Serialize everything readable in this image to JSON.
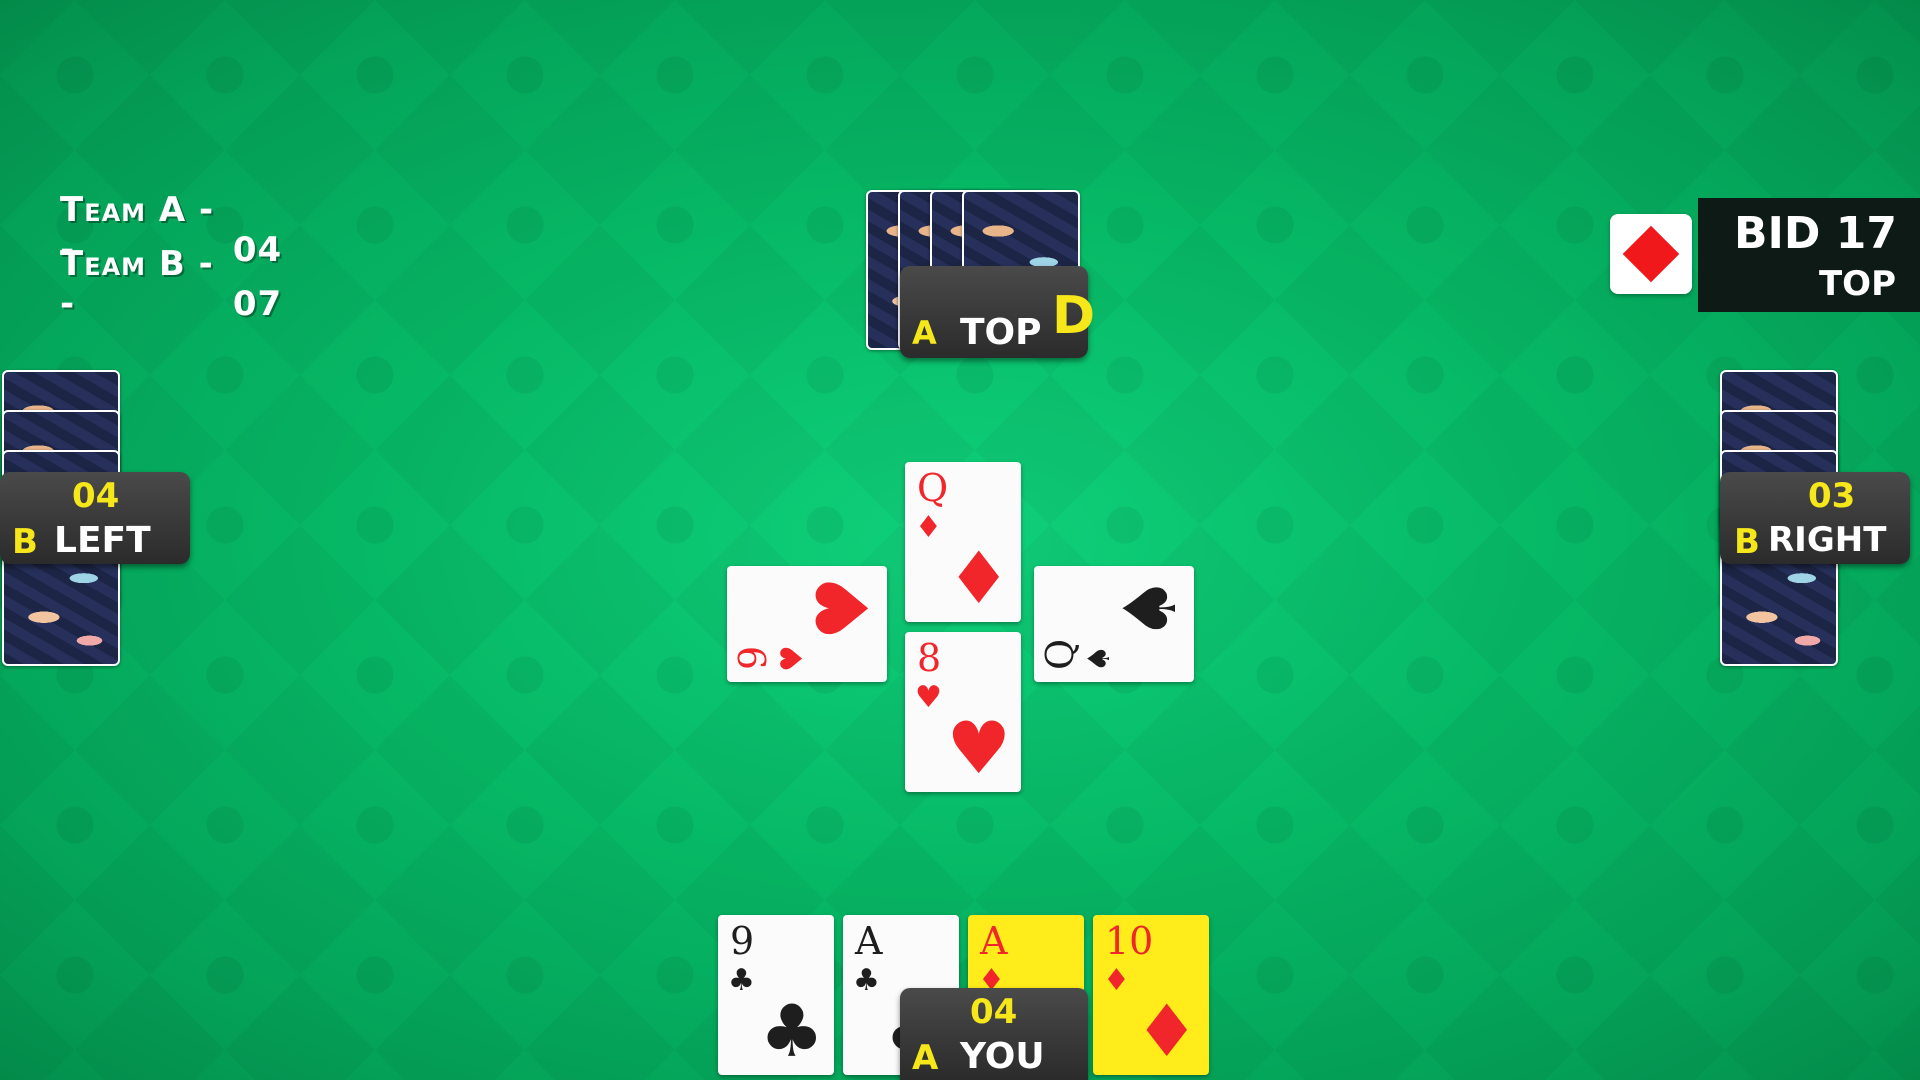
{
  "scoreboard": {
    "team_a_label": "Team A --",
    "team_a_score": "04",
    "team_b_label": "Team B --",
    "team_b_score": "07"
  },
  "bid": {
    "text": "BID 17",
    "by": "TOP",
    "trump_suit": "diamonds"
  },
  "players": {
    "top": {
      "team": "A",
      "name": "TOP",
      "dealer_badge": "D"
    },
    "left": {
      "team": "B",
      "name": "LEFT",
      "count": "04"
    },
    "right": {
      "team": "B",
      "name": "RIGHT",
      "count": "03"
    },
    "you": {
      "team": "A",
      "name": "YOU",
      "count": "04"
    }
  },
  "trick": {
    "top": {
      "rank": "Q",
      "suit": "♦"
    },
    "bottom": {
      "rank": "8",
      "suit": "♥"
    },
    "left": {
      "rank": "9",
      "suit": "♥"
    },
    "right": {
      "rank": "Q",
      "suit": "♠"
    }
  },
  "hand": [
    {
      "rank": "9",
      "suit": "♣",
      "highlight": false
    },
    {
      "rank": "A",
      "suit": "♣",
      "highlight": false
    },
    {
      "rank": "A",
      "suit": "♦",
      "highlight": true
    },
    {
      "rank": "10",
      "suit": "♦",
      "highlight": true
    }
  ],
  "colors": {
    "table_green": "#06b865",
    "highlight": "#ffec1a",
    "team_label": "#f6e71a",
    "red_suit": "#f1262a"
  }
}
